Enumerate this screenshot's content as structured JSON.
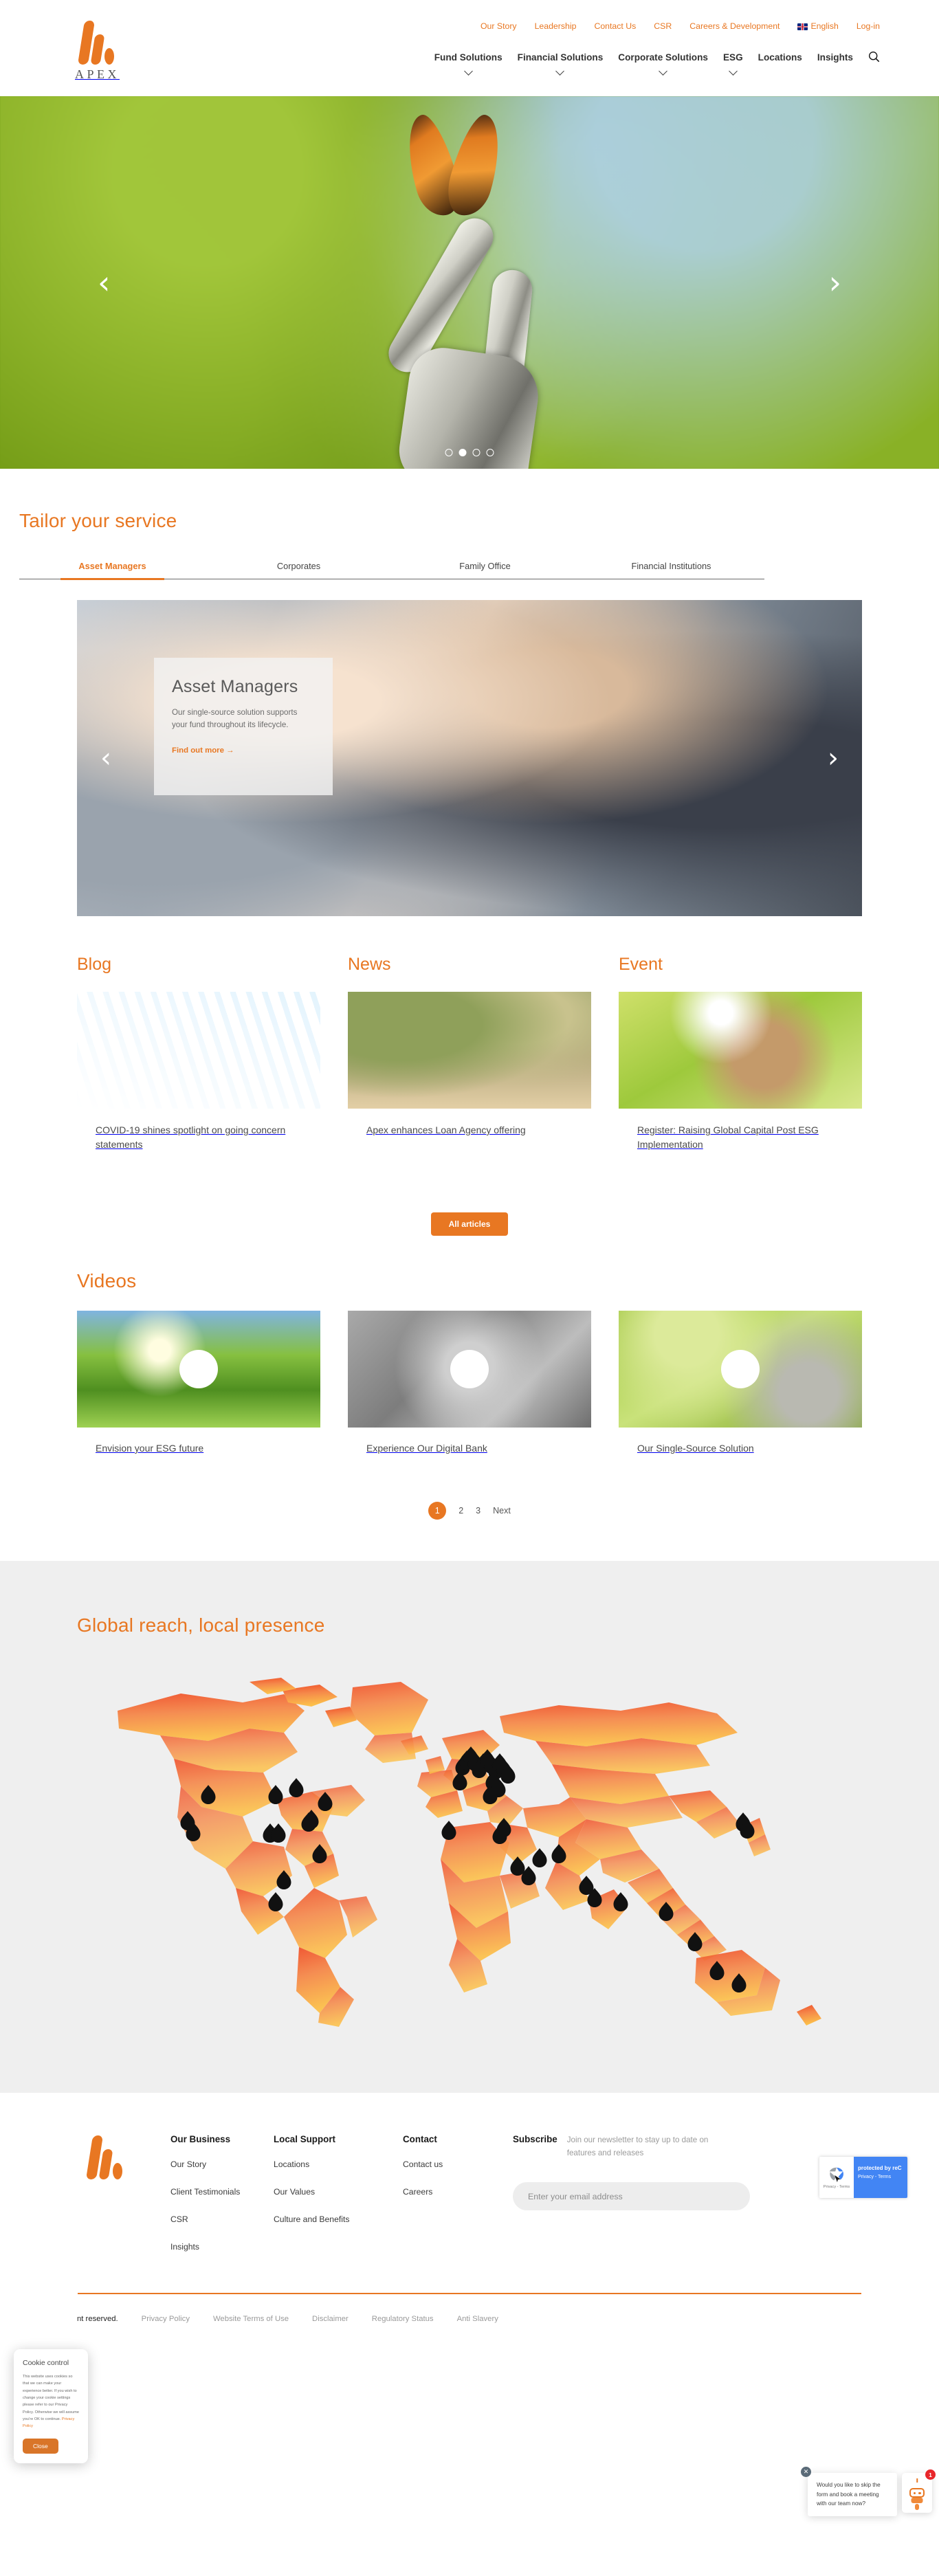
{
  "brand": {
    "name": "APEX",
    "accent": "#E87722"
  },
  "header": {
    "top_links": [
      {
        "label": "Our Story"
      },
      {
        "label": "Leadership"
      },
      {
        "label": "Contact Us"
      },
      {
        "label": "CSR"
      },
      {
        "label": "Careers & Development"
      }
    ],
    "language": "English",
    "login": "Log-in",
    "main_nav": [
      {
        "label": "Fund Solutions",
        "dropdown": true
      },
      {
        "label": "Financial Solutions",
        "dropdown": true
      },
      {
        "label": "Corporate Solutions",
        "dropdown": true
      },
      {
        "label": "ESG",
        "dropdown": true
      },
      {
        "label": "Locations",
        "dropdown": false
      },
      {
        "label": "Insights",
        "dropdown": false
      }
    ],
    "search_icon": "search-icon"
  },
  "hero": {
    "prev": "‹",
    "next": "›",
    "slide_count": 4,
    "active_slide": 2
  },
  "tailor": {
    "title": "Tailor your service",
    "tabs": [
      {
        "label": "Asset Managers",
        "active": true
      },
      {
        "label": "Corporates",
        "active": false
      },
      {
        "label": "Family Office",
        "active": false
      },
      {
        "label": "Financial Institutions",
        "active": false
      }
    ],
    "panel": {
      "heading": "Asset Managers",
      "body": "Our single-source solution supports your fund throughout its lifecycle.",
      "cta": "Find out more",
      "cta_arrow": "→",
      "prev": "‹",
      "next": "›"
    }
  },
  "articles": {
    "columns": [
      {
        "heading": "Blog",
        "card_title": "COVID-19 shines spotlight on going concern statements",
        "image_alt": "charts-and-reports-image"
      },
      {
        "heading": "News",
        "card_title": "Apex enhances Loan Agency offering",
        "image_alt": "loan-bag-and-bar-chart-image"
      },
      {
        "heading": "Event",
        "card_title": "Register: Raising Global Capital Post ESG Implementation",
        "image_alt": "hands-holding-seedling-image"
      }
    ],
    "all_button": "All articles"
  },
  "videos": {
    "title": "Videos",
    "items": [
      {
        "title": "Envision your ESG future",
        "image_alt": "sunlit-tree-image"
      },
      {
        "title": "Experience Our Digital Bank",
        "image_alt": "bank-vault-door-image"
      },
      {
        "title": "Our Single-Source Solution",
        "image_alt": "butterfly-on-robot-hand-image"
      }
    ],
    "pagination": [
      {
        "label": "1",
        "current": true
      },
      {
        "label": "2",
        "current": false
      },
      {
        "label": "3",
        "current": false
      },
      {
        "label": "Next",
        "current": false
      }
    ]
  },
  "map": {
    "title": "Global reach, local presence",
    "pin_count": 41
  },
  "footer": {
    "columns": [
      {
        "heading": "Our Business",
        "links": [
          "Our Story",
          "Client Testimonials",
          "CSR",
          "Insights"
        ]
      },
      {
        "heading": "Local Support",
        "links": [
          "Locations",
          "Our Values",
          "Culture and Benefits"
        ]
      },
      {
        "heading": "Contact",
        "links": [
          "Contact us",
          "Careers"
        ]
      }
    ],
    "subscribe": {
      "heading": "Subscribe",
      "blurb": "Join our newsletter to stay up to date on features and releases",
      "placeholder": "Enter your email address"
    },
    "recaptcha": {
      "protected": "protected by reC",
      "privacy_terms": "Privacy - Terms",
      "badge_label": "Privacy - Terms"
    },
    "copyright": "nt reserved.",
    "legal_links": [
      "Privacy Policy",
      "Website Terms of Use",
      "Disclaimer",
      "Regulatory Status",
      "Anti Slavery"
    ]
  },
  "cookie": {
    "title": "Cookie control",
    "body": "This website uses cookies so that we can make your experience better. If you wish to change your cookie settings please refer to our Privacy Policy. Otherwise we will assume you’re OK to continue.",
    "policy_link": "Privacy Policy",
    "close": "Close"
  },
  "chat": {
    "message": "Would you like to skip the form and book a meeting with our team now?",
    "close": "✕",
    "badge": "1"
  }
}
